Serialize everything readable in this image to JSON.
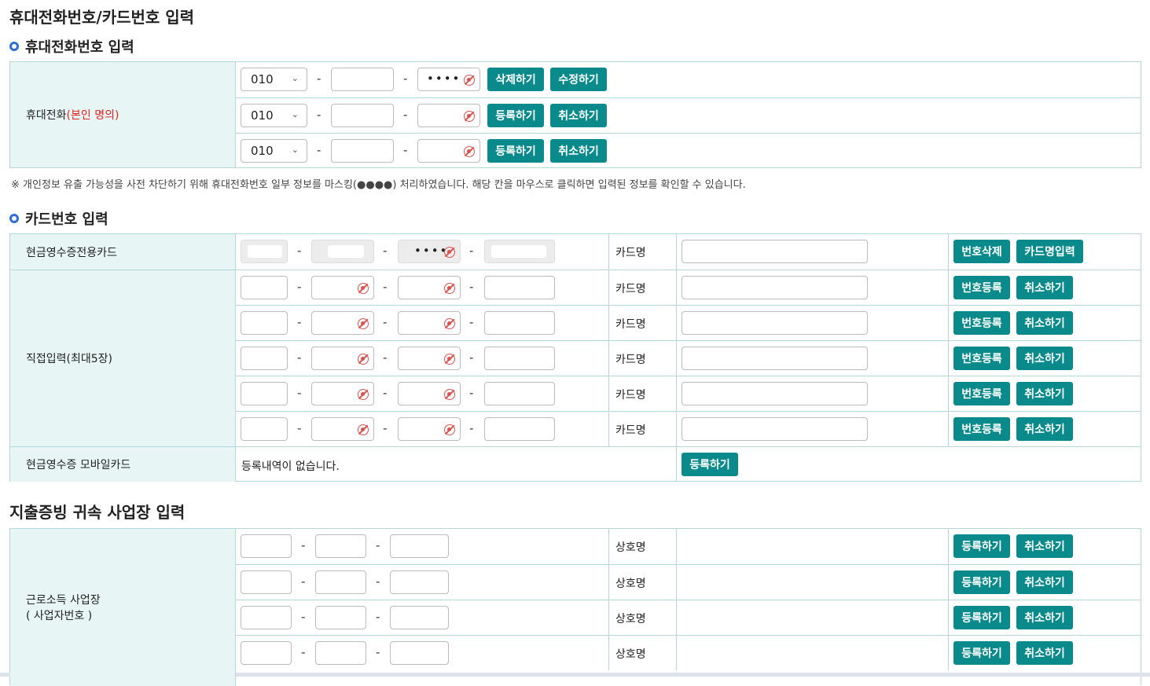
{
  "page_title": "휴대전화번호/카드번호 입력",
  "phone_section": {
    "title": "휴대전화번호 입력",
    "label": "휴대전화",
    "label_highlight": "(본인 명의)",
    "rows": [
      {
        "prefix": "010",
        "middle": "",
        "last_mask": "••••",
        "btn1": "삭제하기",
        "btn2": "수정하기"
      },
      {
        "prefix": "010",
        "middle": "",
        "last_mask": "",
        "btn1": "등록하기",
        "btn2": "취소하기"
      },
      {
        "prefix": "010",
        "middle": "",
        "last_mask": "",
        "btn1": "등록하기",
        "btn2": "취소하기"
      }
    ],
    "dash": "-",
    "notice": "※ 개인정보 유출 가능성을 사전 차단하기 위해 휴대전화번호 일부 정보를 마스킹(●●●●) 처리하였습니다. 해당 칸을 마우스로 클릭하면 입력된 정보를 확인할 수 있습니다."
  },
  "card_section": {
    "title": "카드번호 입력",
    "dash": "-",
    "card_name_label": "카드명",
    "cash_card": {
      "label": "현금영수증전용카드",
      "third_mask": "••••",
      "btn1": "번호삭제",
      "btn2": "카드명입력"
    },
    "direct": {
      "label": "직접입력(최대5장)",
      "rows": [
        {
          "btn1": "번호등록",
          "btn2": "취소하기"
        },
        {
          "btn1": "번호등록",
          "btn2": "취소하기"
        },
        {
          "btn1": "번호등록",
          "btn2": "취소하기"
        },
        {
          "btn1": "번호등록",
          "btn2": "취소하기"
        },
        {
          "btn1": "번호등록",
          "btn2": "취소하기"
        }
      ]
    },
    "mobile": {
      "label": "현금영수증 모바일카드",
      "text": "등록내역이 없습니다.",
      "btn": "등록하기"
    }
  },
  "business_section": {
    "title": "지출증빙 귀속 사업장 입력",
    "label_line1": "근로소득 사업장",
    "label_line2": "( 사업자번호 )",
    "dash": "-",
    "name_label": "상호명",
    "rows": [
      {
        "btn1": "등록하기",
        "btn2": "취소하기"
      },
      {
        "btn1": "등록하기",
        "btn2": "취소하기"
      },
      {
        "btn1": "등록하기",
        "btn2": "취소하기"
      },
      {
        "btn1": "등록하기",
        "btn2": "취소하기"
      }
    ]
  },
  "colors": {
    "button": "#0b8a8c",
    "label_bg": "#e8f5f5",
    "border": "#b7d6d6",
    "highlight": "#e0231e",
    "bullet": "#2f6fd6"
  }
}
